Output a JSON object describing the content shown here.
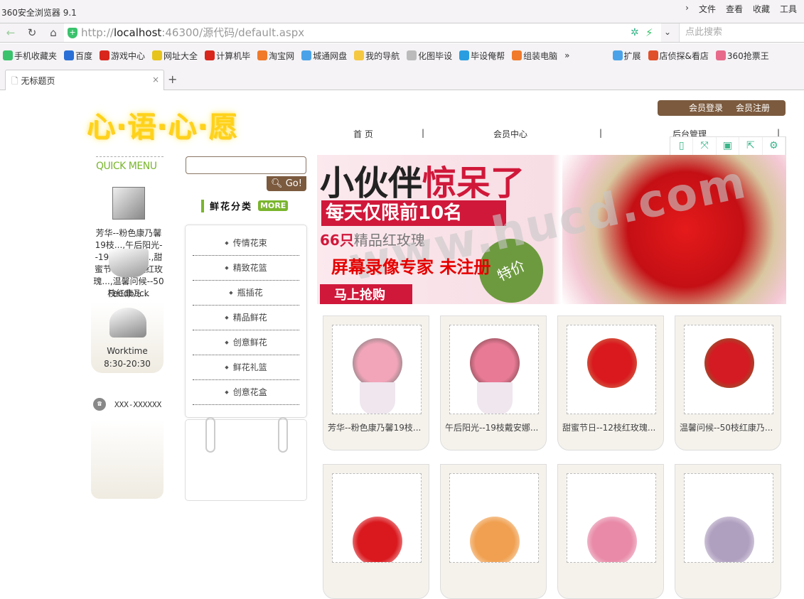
{
  "browser": {
    "title": "360安全浏览器 9.1",
    "menu": [
      "文件",
      "查看",
      "收藏",
      "工具"
    ],
    "url_host": "http://",
    "url_bold": "localhost",
    "url_rest": ":46300/源代码/default.aspx",
    "search_placeholder": "点此搜索",
    "bookmarks": [
      {
        "label": "手机收藏夹",
        "color": "#3bc26c"
      },
      {
        "label": "百度",
        "color": "#2a6fd6"
      },
      {
        "label": "游戏中心",
        "color": "#d8261c"
      },
      {
        "label": "网址大全",
        "color": "#e6c41b"
      },
      {
        "label": "计算机毕",
        "color": "#d8261c"
      },
      {
        "label": "淘宝网",
        "color": "#f07a2a"
      },
      {
        "label": "城通网盘",
        "color": "#4aa3e8"
      },
      {
        "label": "我的导航",
        "color": "#f5c842"
      },
      {
        "label": "化图毕设",
        "color": "#bbbbbb"
      },
      {
        "label": "毕设俺帮",
        "color": "#2a9de0"
      },
      {
        "label": "组装电脑",
        "color": "#f07a2a"
      },
      {
        "label": "»",
        "color": ""
      },
      {
        "label": "扩展",
        "color": "#4aa3e8"
      },
      {
        "label": "店侦探&看店",
        "color": "#e0502a"
      },
      {
        "label": "360抢票王",
        "color": "#e86a8a"
      }
    ],
    "tab": {
      "title": "无标题页"
    }
  },
  "site": {
    "logo": "心·语·心·愿",
    "login": "会员登录",
    "register": "会员注册",
    "nav": [
      "首 页",
      "会员中心",
      "后台管理"
    ],
    "quick_menu": "QUICK MENU",
    "products": [
      "芳华--粉色康乃馨19枝...",
      "午后阳光--19枝戴安娜...",
      "甜蜜节日--12枝红玫瑰...",
      "温馨问候--50枝红康乃..."
    ],
    "feedback": "Feedback",
    "worktime": "Worktime",
    "hours": "8:30-20:30",
    "phone": "XXX-XXXXXX",
    "search_value": "",
    "go": "Go!",
    "category_title": "鲜花分类",
    "more": "MORE",
    "categories": [
      "传情花束",
      "精致花篮",
      "瓶插花",
      "精品鲜花",
      "创意鲜花",
      "鲜花礼篮",
      "创意花盒"
    ],
    "banner": {
      "l1a": "小伙伴",
      "l1b": "惊呆了",
      "l2": "每天仅限前10名",
      "l3a": "66只",
      "l3b": "精品红玫瑰",
      "buy": "马上抢购",
      "badge": "特价",
      "watermark": "屏幕录像专家  未注册",
      "site_watermark": "www.hucd.com"
    },
    "colors": {
      "brown": "#7b5a3e",
      "green": "#7ab52e",
      "red": "#d0183a"
    }
  }
}
